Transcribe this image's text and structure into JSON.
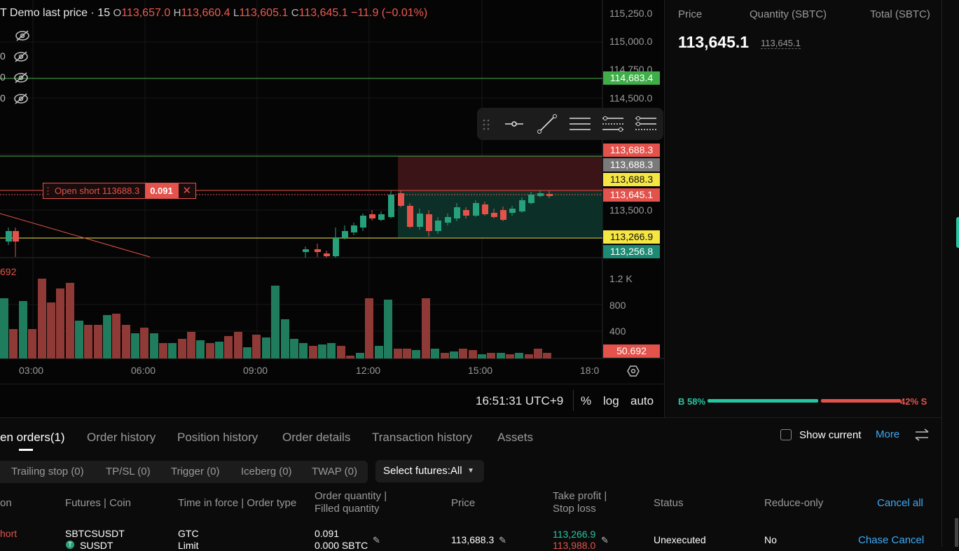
{
  "chart": {
    "title": "T Demo last price · 15",
    "ohlc": {
      "o_label": "O",
      "o": "113,657.0",
      "h_label": "H",
      "h": "113,660.4",
      "l_label": "L",
      "l": "113,605.1",
      "c_label": "C",
      "c": "113,645.1",
      "change": "−11.9 (−0.01%)"
    },
    "indicator_rows": [
      "0",
      "0",
      "0"
    ],
    "price_ticks": [
      "115,250.0",
      "115,000.0",
      "114,750.0",
      "114,500.0",
      "113,500.0"
    ],
    "price_tags": {
      "take_profit_line": "114,683.4",
      "entry_red": "113,688.3",
      "entry_gray": "113,688.3",
      "entry_yellow": "113,688.3",
      "last_price": "113,645.1",
      "tp_yellow": "113,266.9",
      "low_teal": "113,256.8"
    },
    "volume_ticks": [
      "1.2 K",
      "800",
      "400"
    ],
    "volume_value": "50.692",
    "indicator_left_value": "692",
    "time_ticks": [
      "03:00",
      "06:00",
      "09:00",
      "12:00",
      "15:00",
      "18:0"
    ],
    "order_label": {
      "text": "Open short 113688.3",
      "qty": "0.091"
    },
    "clock": "16:51:31 UTC+9",
    "percent_button": "%",
    "log_button": "log",
    "auto_button": "auto",
    "colors": {
      "up": "#26a17b",
      "down": "#e3534b",
      "yellow": "#f5e642"
    }
  },
  "order_book": {
    "headers": [
      "Price",
      "Quantity (SBTC)",
      "Total (SBTC)"
    ],
    "last_price": "113,645.1",
    "last_price_mark": "113,645.1",
    "buy_ratio": "B 58%",
    "sell_ratio": "42% S",
    "buy_fraction": 0.58
  },
  "bottom": {
    "tabs": [
      "en orders(1)",
      "Order history",
      "Position history",
      "Order details",
      "Transaction history",
      "Assets"
    ],
    "show_current": "Show current",
    "more": "More",
    "subtabs": [
      "Trailing stop (0)",
      "TP/SL (0)",
      "Trigger (0)",
      "Iceberg (0)",
      "TWAP (0)"
    ],
    "select_futures": "Select futures:All",
    "columns": {
      "c0": "on",
      "c1": "Futures | Coin",
      "c2": "Time in force | Order type",
      "c3a": "Order quantity |",
      "c3b": "Filled quantity",
      "c4": "Price",
      "c5a": "Take profit |",
      "c5b": "Stop loss",
      "c6": "Status",
      "c7": "Reduce-only",
      "c8": "Cancel all"
    },
    "row": {
      "side": "hort",
      "symbol": "SBTCSUSDT",
      "coin": "SUSDT",
      "tif": "GTC",
      "type": "Limit",
      "qty": "0.091",
      "filled": "0.000 SBTC",
      "price": "113,688.3",
      "tp": "113,266.9",
      "sl": "113,988.0",
      "status": "Unexecuted",
      "reduce": "No",
      "action": "Chase Cancel"
    }
  }
}
